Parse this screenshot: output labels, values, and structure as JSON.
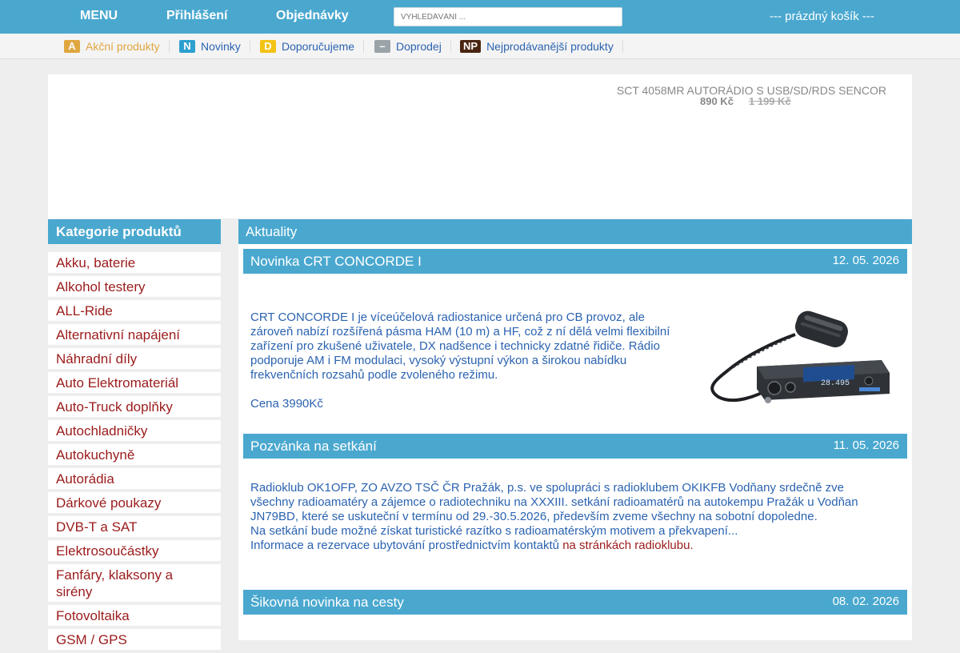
{
  "topbar": {
    "menu": "MENU",
    "login": "Přihlášení",
    "orders": "Objednávky",
    "search_placeholder": "VYHLEDÁVÁNÍ ...",
    "cart": "--- prázdný košík ---"
  },
  "subnav": [
    {
      "badge": "A",
      "label": "Akční produkty",
      "badge_color": "#e0a640",
      "text_color": "#e0a640"
    },
    {
      "badge": "N",
      "label": "Novinky",
      "badge_color": "#2d9fd0",
      "text_color": "#2b63b0"
    },
    {
      "badge": "D",
      "label": "Doporučujeme",
      "badge_color": "#f3c316",
      "text_color": "#2b63b0"
    },
    {
      "badge": "–",
      "label": "Doprodej",
      "badge_color": "#9aa3a8",
      "text_color": "#2b63b0"
    },
    {
      "badge": "NP",
      "label": "Nejprodávanější produkty",
      "badge_color": "#4a2412",
      "text_color": "#2b63b0"
    }
  ],
  "banner": {
    "product": "SCT 4058MR AUTORÁDIO S USB/SD/RDS SENCOR",
    "price": "890  Kč",
    "old_price": " 1 199  Kč "
  },
  "sidebar": {
    "title": "Kategorie produktů",
    "items": [
      "Akku, baterie",
      "Alkohol testery",
      "ALL-Ride",
      "Alternativní napájení",
      "Náhradní díly",
      "Auto Elektromateriál",
      "Auto-Truck doplňky",
      "Autochladničky",
      "Autokuchyně",
      "Autorádia",
      "Dárkové poukazy",
      "DVB-T a SAT",
      "Elektrosoučástky",
      "Fanfáry, klaksony a sirény",
      "Fotovoltaika",
      "GSM / GPS"
    ]
  },
  "content": {
    "title": "Aktuality",
    "news": [
      {
        "title": "Novinka CRT CONCORDE I",
        "date": "12. 05. 2026",
        "lines": [
          "CRT CONCORDE I je víceúčelová radiostanice určená pro CB provoz, ale",
          "zároveň nabízí rozšířená pásma HAM (10 m) a HF, což z ní dělá velmi flexibilní",
          "zařízení pro zkušené uživatele, DX nadšence i technicky zdatné řidiče. Rádio",
          "podporuje AM i FM modulaci, vysoký výstupní výkon a širokou nabídku",
          "frekvenčních rozsahů podle zvoleného režimu."
        ],
        "price": "Cena 3990Kč",
        "display": "28.495"
      },
      {
        "title": "Pozvánka na setkání",
        "date": "11. 05. 2026",
        "lines": [
          "Radioklub OK1OFP, ZO AVZO TSČ ČR Pražák, p.s. ve spolupráci s radioklubem OKIKFB Vodňany srdečně zve",
          "všechny radioamatéry a zájemce o radiotechniku na XXXIII. setkání radioamatérů na autokempu Pražák u Vodňan",
          "JN79BD, které se uskuteční v termínu od 29.-30.5.2026, především zveme všechny na sobotní dopoledne.",
          "Na setkání bude možné získat turistické razítko s radioamatérským motivem a překvapení..."
        ],
        "info": "Informace a rezervace ubytování prostřednictvím kontaktů ",
        "link": "na stránkách radioklubu."
      },
      {
        "title": "Šikovná novinka na cesty",
        "date": "08. 02. 2026"
      }
    ]
  }
}
